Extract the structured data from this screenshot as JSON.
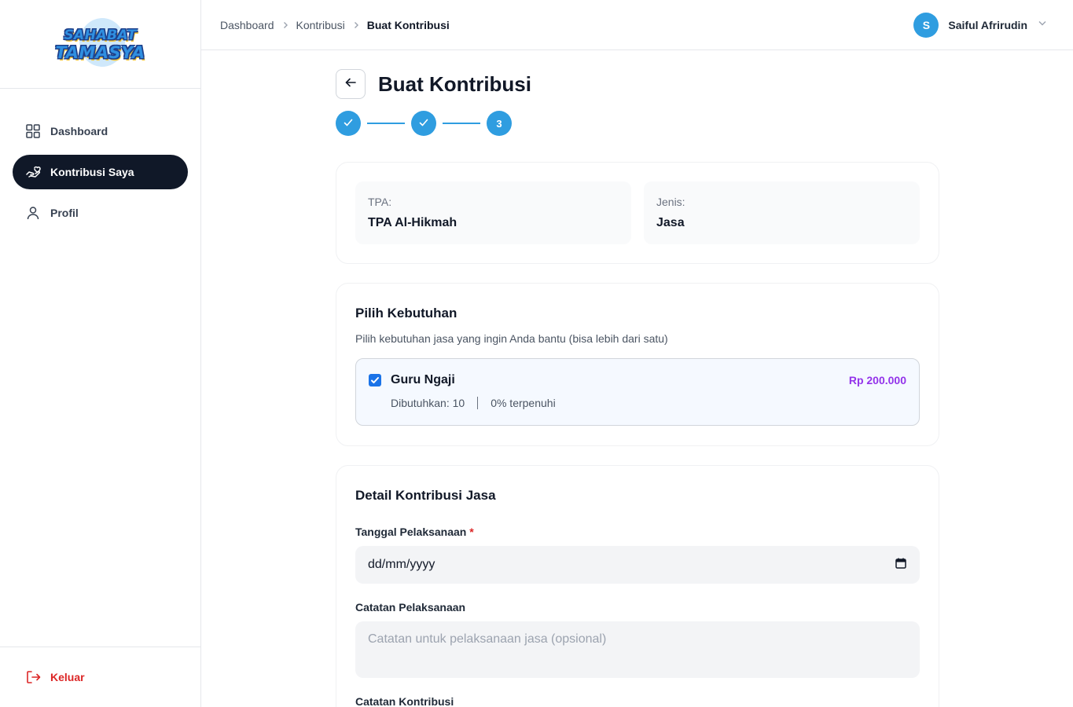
{
  "app": {
    "logo_line1": "SAHABAT",
    "logo_line2": "TAMASYA"
  },
  "sidebar": {
    "items": [
      {
        "label": "Dashboard",
        "icon": "grid-icon",
        "active": false
      },
      {
        "label": "Kontribusi Saya",
        "icon": "hand-heart-icon",
        "active": true
      },
      {
        "label": "Profil",
        "icon": "user-icon",
        "active": false
      }
    ],
    "logout_label": "Keluar"
  },
  "header": {
    "breadcrumb": [
      "Dashboard",
      "Kontribusi",
      "Buat Kontribusi"
    ],
    "user_initial": "S",
    "user_name": "Saiful Afrirudin"
  },
  "page": {
    "title": "Buat Kontribusi",
    "steps": [
      {
        "state": "done"
      },
      {
        "state": "done"
      },
      {
        "state": "current",
        "label": "3"
      }
    ]
  },
  "info": {
    "tpa_label": "TPA:",
    "tpa_value": "TPA Al-Hikmah",
    "jenis_label": "Jenis:",
    "jenis_value": "Jasa"
  },
  "needs": {
    "title": "Pilih Kebutuhan",
    "subtitle": "Pilih kebutuhan jasa yang ingin Anda bantu (bisa lebih dari satu)",
    "items": [
      {
        "name": "Guru Ngaji",
        "price": "Rp 200.000",
        "needed": "Dibutuhkan: 10",
        "fulfilled": "0% terpenuhi",
        "checked": true
      }
    ]
  },
  "detail": {
    "title": "Detail Kontribusi Jasa",
    "date_label": "Tanggal Pelaksanaan",
    "date_required": "*",
    "date_value": "dd/mm/yyyy",
    "notes_label": "Catatan Pelaksanaan",
    "notes_placeholder": "Catatan untuk pelaksanaan jasa (opsional)",
    "contrib_notes_label": "Catatan Kontribusi"
  },
  "colors": {
    "primary": "#2f9de0",
    "sidebar_active": "#101828",
    "price": "#9333ea",
    "danger": "#dc2626"
  }
}
